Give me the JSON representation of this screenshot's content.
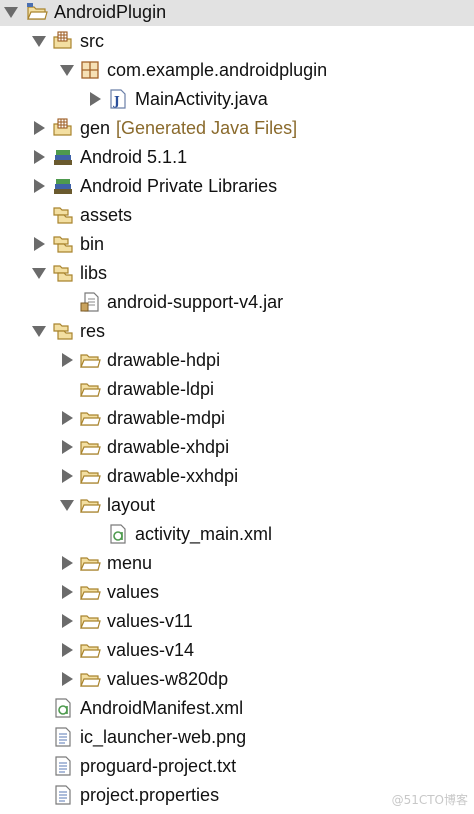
{
  "tree": {
    "items": [
      {
        "label": "AndroidPlugin",
        "level": 0,
        "expanded": true,
        "icon": "java-project-icon",
        "selected": true
      },
      {
        "label": "src",
        "level": 1,
        "expanded": true,
        "icon": "source-folder-icon"
      },
      {
        "label": "com.example.androidplugin",
        "level": 2,
        "expanded": true,
        "icon": "package-icon"
      },
      {
        "label": "MainActivity.java",
        "level": 3,
        "expanded": false,
        "icon": "java-file-icon"
      },
      {
        "label": "gen",
        "decoration": "[Generated Java Files]",
        "level": 1,
        "expanded": false,
        "icon": "source-folder-icon"
      },
      {
        "label": "Android 5.1.1",
        "level": 1,
        "expanded": false,
        "icon": "library-icon"
      },
      {
        "label": "Android Private Libraries",
        "level": 1,
        "expanded": false,
        "icon": "library-icon"
      },
      {
        "label": "assets",
        "level": 1,
        "icon": "folder-icon"
      },
      {
        "label": "bin",
        "level": 1,
        "expanded": false,
        "icon": "folder-icon"
      },
      {
        "label": "libs",
        "level": 1,
        "expanded": true,
        "icon": "folder-icon"
      },
      {
        "label": "android-support-v4.jar",
        "level": 2,
        "icon": "jar-file-icon"
      },
      {
        "label": "res",
        "level": 1,
        "expanded": true,
        "icon": "folder-icon"
      },
      {
        "label": "drawable-hdpi",
        "level": 2,
        "expanded": false,
        "icon": "open-folder-icon"
      },
      {
        "label": "drawable-ldpi",
        "level": 2,
        "icon": "open-folder-icon"
      },
      {
        "label": "drawable-mdpi",
        "level": 2,
        "expanded": false,
        "icon": "open-folder-icon"
      },
      {
        "label": "drawable-xhdpi",
        "level": 2,
        "expanded": false,
        "icon": "open-folder-icon"
      },
      {
        "label": "drawable-xxhdpi",
        "level": 2,
        "expanded": false,
        "icon": "open-folder-icon"
      },
      {
        "label": "layout",
        "level": 2,
        "expanded": true,
        "icon": "open-folder-icon"
      },
      {
        "label": "activity_main.xml",
        "level": 3,
        "icon": "xml-file-icon"
      },
      {
        "label": "menu",
        "level": 2,
        "expanded": false,
        "icon": "open-folder-icon"
      },
      {
        "label": "values",
        "level": 2,
        "expanded": false,
        "icon": "open-folder-icon"
      },
      {
        "label": "values-v11",
        "level": 2,
        "expanded": false,
        "icon": "open-folder-icon"
      },
      {
        "label": "values-v14",
        "level": 2,
        "expanded": false,
        "icon": "open-folder-icon"
      },
      {
        "label": "values-w820dp",
        "level": 2,
        "expanded": false,
        "icon": "open-folder-icon"
      },
      {
        "label": "AndroidManifest.xml",
        "level": 1,
        "icon": "xml-file-icon"
      },
      {
        "label": "ic_launcher-web.png",
        "level": 1,
        "icon": "file-icon"
      },
      {
        "label": "proguard-project.txt",
        "level": 1,
        "icon": "file-icon"
      },
      {
        "label": "project.properties",
        "level": 1,
        "icon": "file-icon"
      }
    ]
  },
  "watermark": "@51CTO博客",
  "colors": {
    "selection": "#e2e2e2",
    "text": "#111111",
    "decoration": "#8a6a2c",
    "twisty": "#6b6b6b",
    "folder_fill": "#f3dfa2",
    "folder_stroke": "#a9842e"
  }
}
